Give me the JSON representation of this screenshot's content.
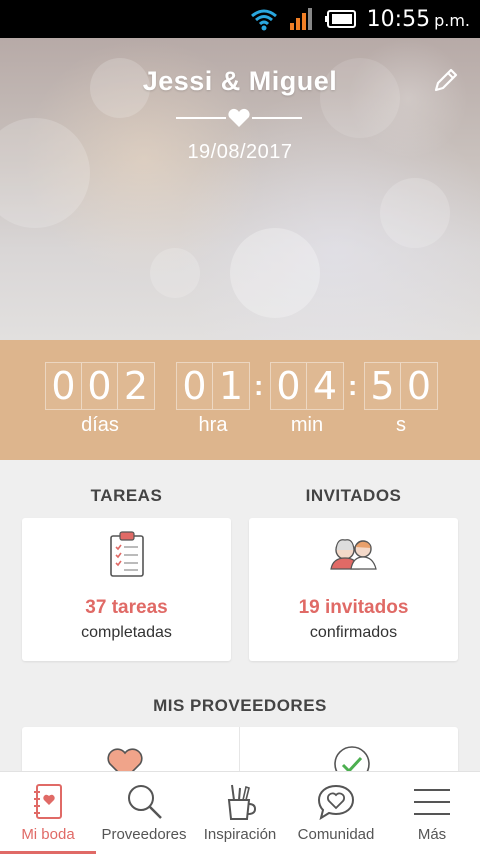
{
  "status_bar": {
    "time": "10:55",
    "ampm": "p.m."
  },
  "hero": {
    "couple": "Jessi & Miguel",
    "date": "19/08/2017"
  },
  "countdown": {
    "days": [
      "0",
      "0",
      "2"
    ],
    "hours": [
      "0",
      "1"
    ],
    "minutes": [
      "0",
      "4"
    ],
    "seconds": [
      "5",
      "0"
    ],
    "labels": {
      "days": "días",
      "hours": "hra",
      "minutes": "min",
      "seconds": "s"
    }
  },
  "tasks": {
    "heading": "TAREAS",
    "count": "37 tareas",
    "caption": "completadas"
  },
  "guests": {
    "heading": "INVITADOS",
    "count": "19 invitados",
    "caption": "confirmados"
  },
  "vendors": {
    "heading": "MIS PROVEEDORES"
  },
  "nav": {
    "items": [
      {
        "label": "Mi boda",
        "icon": "notebook-icon"
      },
      {
        "label": "Proveedores",
        "icon": "search-icon"
      },
      {
        "label": "Inspiración",
        "icon": "pencil-cup-icon"
      },
      {
        "label": "Comunidad",
        "icon": "chat-heart-icon"
      },
      {
        "label": "Más",
        "icon": "menu-icon"
      }
    ]
  },
  "colors": {
    "accent": "#e06a66",
    "countdown_bg": "#ddb58d"
  }
}
